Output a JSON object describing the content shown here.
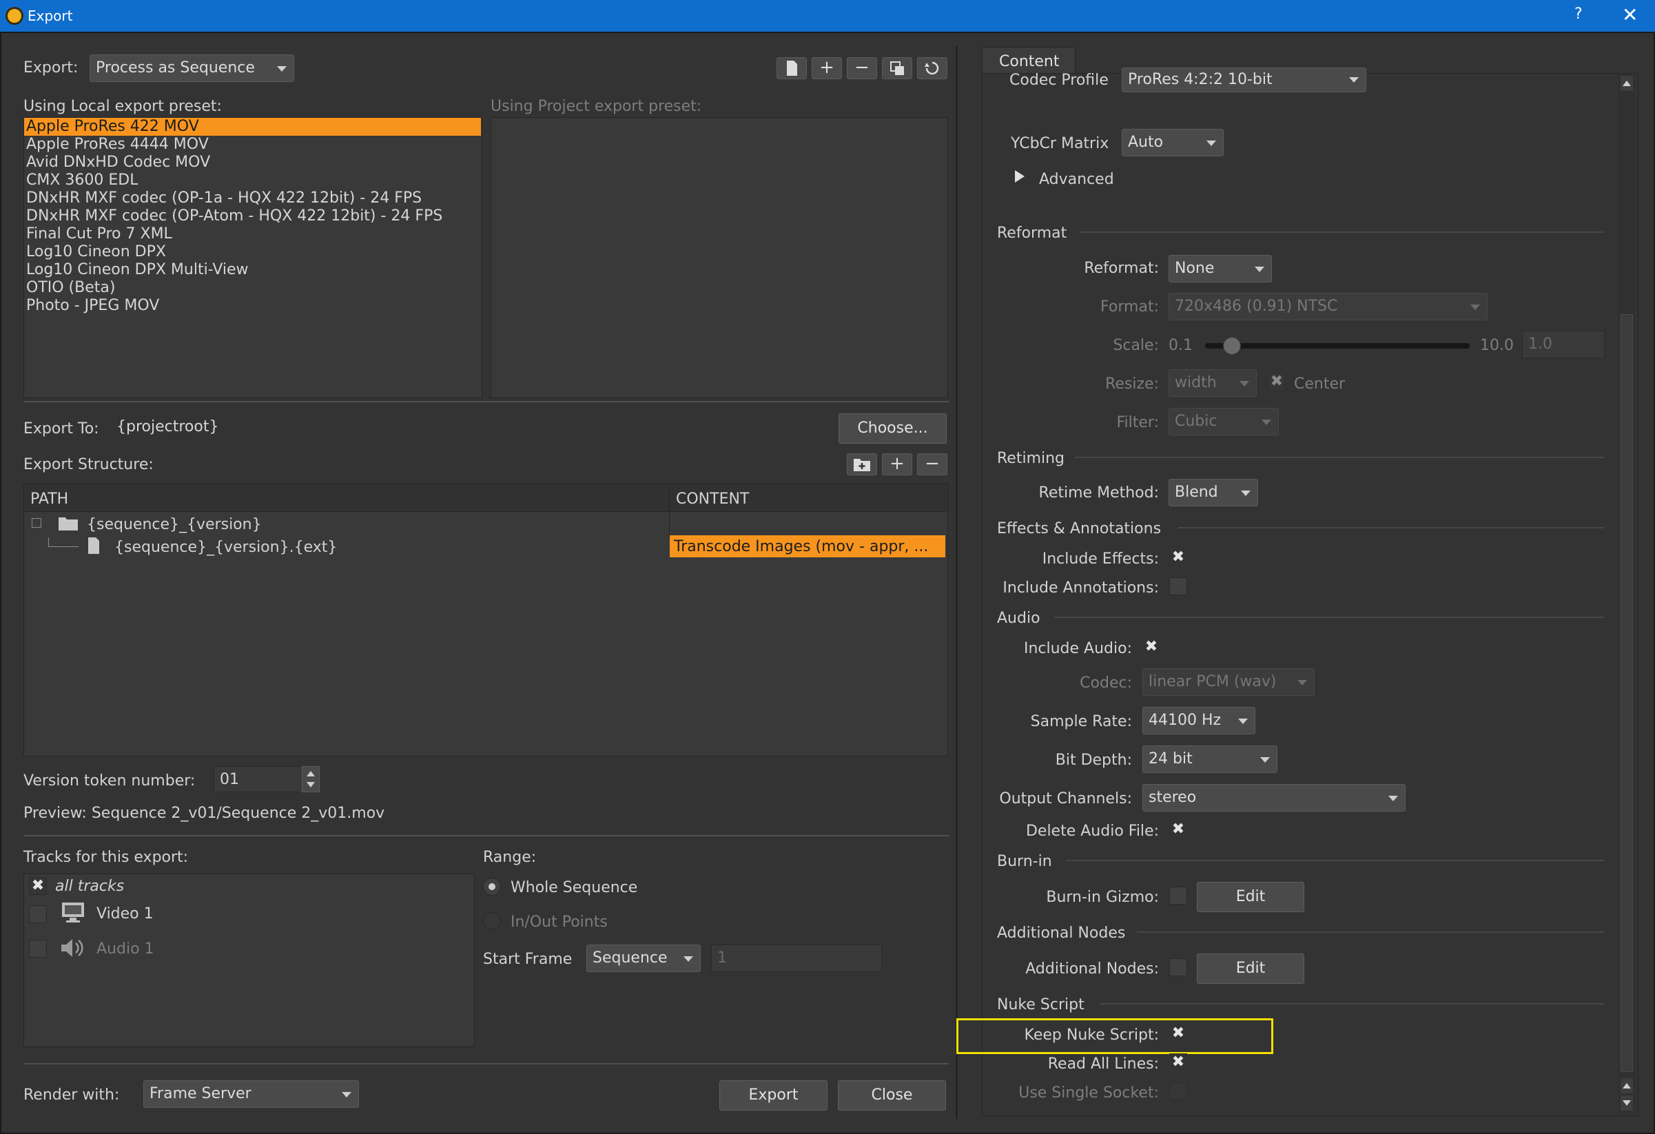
{
  "window": {
    "title": "Export",
    "help": "?",
    "close": "✕"
  },
  "top": {
    "export_label": "Export:",
    "export_mode": "Process as Sequence",
    "local_preset_label": "Using Local export preset:",
    "project_preset_label": "Using Project export preset:"
  },
  "presets": [
    "Apple ProRes 422 MOV",
    "Apple ProRes 4444 MOV",
    "Avid DNxHD Codec MOV",
    "CMX 3600 EDL",
    "DNxHR MXF codec (OP-1a - HQX 422 12bit) - 24 FPS",
    "DNxHR MXF codec (OP-Atom - HQX 422 12bit) - 24 FPS",
    "Final Cut Pro 7 XML",
    "Log10 Cineon DPX",
    "Log10 Cineon DPX Multi-View",
    "OTIO (Beta)",
    "Photo - JPEG MOV"
  ],
  "export_to": {
    "label": "Export To:",
    "value": "{projectroot}",
    "choose": "Choose..."
  },
  "structure": {
    "label": "Export Structure:",
    "col_path": "PATH",
    "col_content": "CONTENT",
    "folder": "{sequence}_{version}",
    "file": "{sequence}_{version}.{ext}",
    "file_content": "Transcode Images (mov - appr, ..."
  },
  "version": {
    "label": "Version token number:",
    "value": "01"
  },
  "preview": "Preview: Sequence 2_v01/Sequence 2_v01.mov",
  "tracks": {
    "label": "Tracks for this export:",
    "items": [
      "all tracks",
      "Video 1",
      "Audio 1"
    ]
  },
  "range": {
    "label": "Range:",
    "whole": "Whole Sequence",
    "inout": "In/Out Points",
    "start_label": "Start Frame",
    "start_mode": "Sequence",
    "start_value": "1"
  },
  "render": {
    "label": "Render with:",
    "value": "Frame Server"
  },
  "buttons": {
    "export": "Export",
    "close": "Close"
  },
  "content": {
    "tab": "Content",
    "codec_profile_label": "Codec Profile",
    "codec_profile": "ProRes 4:2:2 10-bit",
    "ycbcr_label": "YCbCr Matrix",
    "ycbcr": "Auto",
    "advanced": "Advanced",
    "reformat_section": "Reformat",
    "reformat_label": "Reformat:",
    "reformat": "None",
    "format_label": "Format:",
    "format": "720x486 (0.91) NTSC",
    "scale_label": "Scale:",
    "scale_min": "0.1",
    "scale_max": "10.0",
    "scale_value": "1.0",
    "resize_label": "Resize:",
    "resize": "width",
    "center": "Center",
    "filter_label": "Filter:",
    "filter": "Cubic",
    "retiming_section": "Retiming",
    "retime_label": "Retime Method:",
    "retime": "Blend",
    "effects_section": "Effects & Annotations",
    "include_effects": "Include Effects:",
    "include_annotations": "Include Annotations:",
    "audio_section": "Audio",
    "include_audio": "Include Audio:",
    "codec_label": "Codec:",
    "codec": "linear PCM (wav)",
    "sample_rate_label": "Sample Rate:",
    "sample_rate": "44100 Hz",
    "bit_depth_label": "Bit Depth:",
    "bit_depth": "24 bit",
    "output_channels_label": "Output Channels:",
    "output_channels": "stereo",
    "delete_audio": "Delete Audio File:",
    "burnin_section": "Burn-in",
    "burnin_gizmo": "Burn-in Gizmo:",
    "edit": "Edit",
    "additional_section": "Additional Nodes",
    "additional_nodes": "Additional Nodes:",
    "nuke_section": "Nuke Script",
    "keep_nuke": "Keep Nuke Script:",
    "read_all": "Read All Lines:",
    "single_socket": "Use Single Socket:"
  },
  "colors": {
    "accent": "#f7941d",
    "highlight": "#f2e000",
    "titlebar": "#0f6ecd"
  }
}
